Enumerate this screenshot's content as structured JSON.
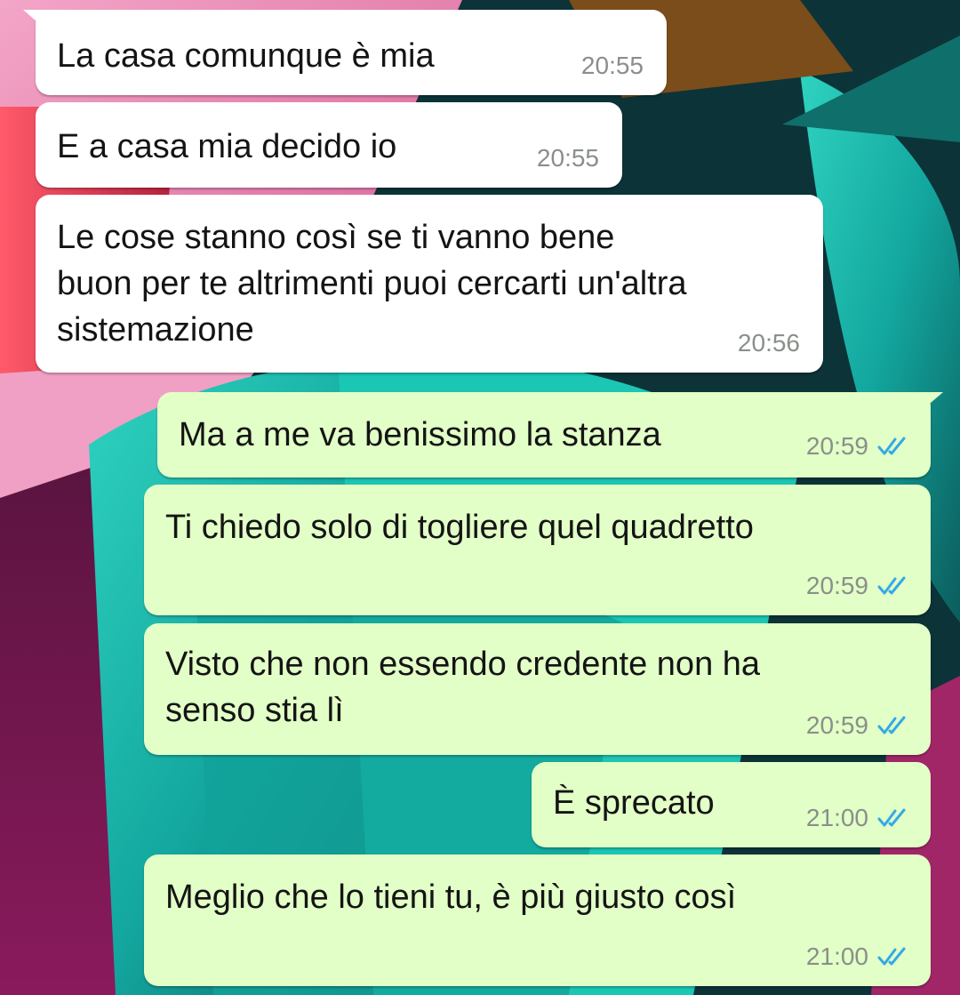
{
  "colors": {
    "incoming_bubble": "#ffffff",
    "outgoing_bubble": "#e2ffc7",
    "timestamp": "#8a8f8a",
    "read_ticks": "#34a9e6"
  },
  "messages": [
    {
      "direction": "incoming",
      "text": "La casa comunque è mia",
      "time": "20:55"
    },
    {
      "direction": "incoming",
      "text": "E a casa mia decido io",
      "time": "20:55"
    },
    {
      "direction": "incoming",
      "text": "Le cose stanno così se ti vanno bene\nbuon per te altrimenti puoi cercarti un'altra\nsistemazione",
      "time": "20:56"
    },
    {
      "direction": "outgoing",
      "text": "Ma a me va benissimo la stanza",
      "time": "20:59",
      "status": "read-ticks-icon"
    },
    {
      "direction": "outgoing",
      "text": "Ti chiedo solo di togliere quel quadretto",
      "time": "20:59",
      "status": "read-ticks-icon"
    },
    {
      "direction": "outgoing",
      "text": "Visto che non essendo credente non ha\nsenso stia lì",
      "time": "20:59",
      "status": "read-ticks-icon"
    },
    {
      "direction": "outgoing",
      "text": "È sprecato",
      "time": "21:00",
      "status": "read-ticks-icon"
    },
    {
      "direction": "outgoing",
      "text": "Meglio che lo tieni tu, è più giusto così",
      "time": "21:00",
      "status": "read-ticks-icon"
    }
  ]
}
